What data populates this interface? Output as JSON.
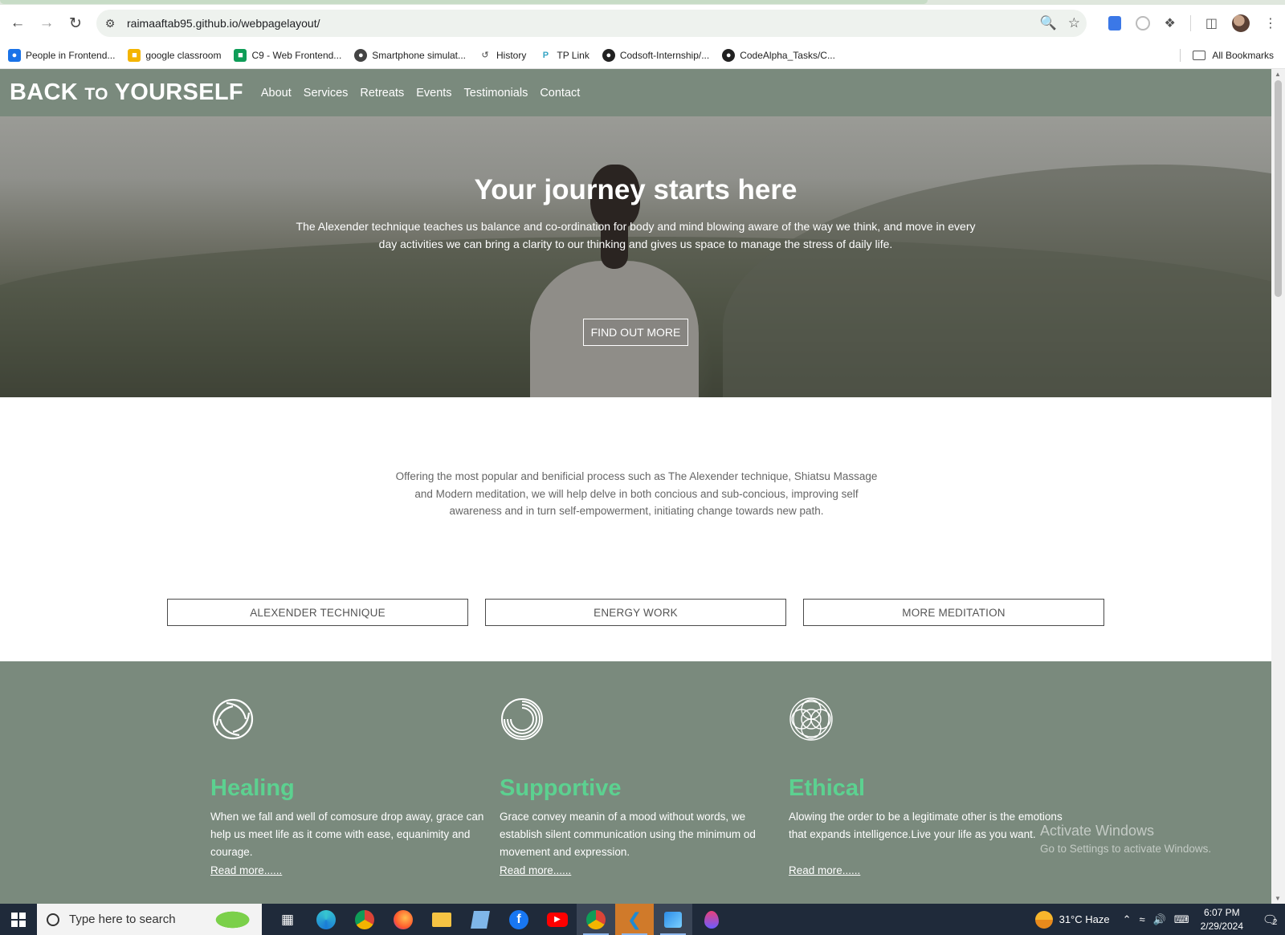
{
  "browser": {
    "url": "raimaaftab95.github.io/webpagelayout/",
    "bookmarks": [
      {
        "label": "People in Frontend...",
        "icon": "person-icon",
        "color": "#1a73e8"
      },
      {
        "label": "google classroom",
        "icon": "classroom-icon",
        "color": "#f4b400"
      },
      {
        "label": "C9 - Web Frontend...",
        "icon": "chat-icon",
        "color": "#0f9d58"
      },
      {
        "label": "Smartphone simulat...",
        "icon": "globe-icon",
        "color": "#444444"
      },
      {
        "label": "History",
        "icon": "history-icon",
        "color": "#444444"
      },
      {
        "label": "TP Link",
        "icon": "tplink-icon",
        "color": "#34a4c4"
      },
      {
        "label": "Codsoft-Internship/...",
        "icon": "github-icon",
        "color": "#222222"
      },
      {
        "label": "CodeAlpha_Tasks/C...",
        "icon": "github-icon",
        "color": "#222222"
      }
    ],
    "all_bookmarks": "All Bookmarks"
  },
  "site": {
    "brand": {
      "part1": "BACK ",
      "part2": "TO",
      "part3": " YOURSELF"
    },
    "nav": [
      "About",
      "Services",
      "Retreats",
      "Events",
      "Testimonials",
      "Contact"
    ],
    "hero": {
      "title": "Your journey starts here",
      "text": "The Alexender technique teaches us balance and co-ordination for body and mind blowing aware of the way we think, and move in every day activities we can bring a clarity to our thinking and gives us space to manage the stress of daily life.",
      "button": "FIND OUT MORE"
    },
    "intro": "Offering the most popular and benificial process such as The Alexender technique, Shiatsu Massage and Modern meditation, we will help delve in both concious and sub-concious, improving self awareness and in turn self-empowerment, initiating change towards new path.",
    "services": [
      "ALEXENDER TECHNIQUE",
      "ENERGY WORK",
      "MORE MEDITATION"
    ],
    "features": [
      {
        "title": "Healing",
        "text": "When we fall and well of comosure drop away, grace can help us meet life as it come with ease, equanimity and courage.",
        "link": "Read more......"
      },
      {
        "title": "Supportive",
        "text": "Grace convey meanin of a mood without words, we establish silent communication using the minimum od movement and expression.",
        "link": "Read more......"
      },
      {
        "title": "Ethical",
        "text": "Alowing the order to be a legitimate other is the emotions that expands intelligence.Live your life as you want.",
        "link": "Read more......"
      }
    ],
    "accent_color": "#5cd190",
    "nav_bg": "#7a8a7d"
  },
  "watermark": {
    "title": "Activate Windows",
    "subtitle": "Go to Settings to activate Windows."
  },
  "taskbar": {
    "search_placeholder": "Type here to search",
    "weather": "31°C  Haze",
    "time": "6:07 PM",
    "date": "2/29/2024",
    "notifications": "2",
    "apps": [
      "task-view-icon",
      "edge-icon",
      "chrome-icon",
      "firefox-icon",
      "file-explorer-icon",
      "notepad-icon",
      "facebook-icon",
      "youtube-icon",
      "chrome-profile-icon",
      "vscode-icon",
      "photos-icon",
      "drop-icon"
    ]
  }
}
